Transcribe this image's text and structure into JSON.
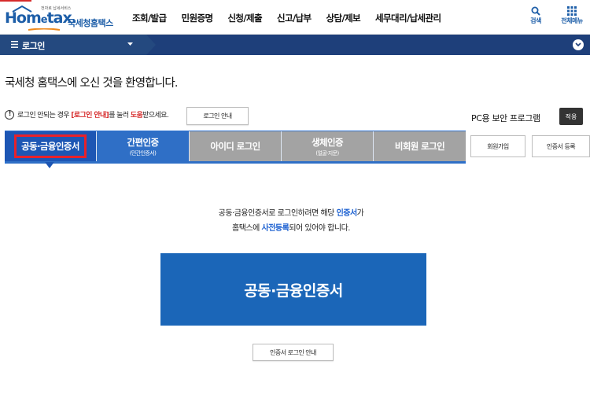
{
  "header": {
    "logo_small": "전자로 납세서비스",
    "logo_brand_a": "Hom",
    "logo_brand_e": "e",
    "logo_brand_b": "tax.",
    "logo_ko": "국세청홈택스",
    "nav": [
      "조회/발급",
      "민원증명",
      "신청/제출",
      "신고/납부",
      "상담/제보",
      "세무대리/납세관리"
    ],
    "search_label": "검색",
    "allmenu_label": "전체메뉴",
    "accent": "#1d5ea8"
  },
  "navbar": {
    "label": "로그인",
    "bg": "#1e3f7a"
  },
  "welcome": "국세청 홈택스에 오신 것을 환영합니다.",
  "notice": {
    "pre": "로그인 안되는 경우",
    "hl1": "[로그인 안내]",
    "mid": "를 눌러",
    "hl2": "도움",
    "post": "받으세요.",
    "guide_button": "로그인 안내"
  },
  "security": {
    "label": "PC용 보안 프로그램",
    "apply_button": "적용"
  },
  "tabs": [
    {
      "label": "공동·금융인증서",
      "sub": "",
      "active": true
    },
    {
      "label": "간편인증",
      "sub": "(민간인증서)",
      "active": false
    },
    {
      "label": "아이디 로그인",
      "sub": "",
      "active": false
    },
    {
      "label": "생체인증",
      "sub": "(얼굴·지문)",
      "active": false
    },
    {
      "label": "비회원 로그인",
      "sub": "",
      "active": false
    }
  ],
  "side_buttons": {
    "join": "회원가입",
    "cert_register": "인증서 등록"
  },
  "description": {
    "line1_pre": "공동·금융인증서로 로그인하려면 해당",
    "line1_hl": "인증서",
    "line1_post": "가",
    "line2_pre": "홈택스에",
    "line2_hl": "사전등록",
    "line2_post": "되어 있어야 합니다."
  },
  "main_button": "공동·금융인증서",
  "cert_guide_button": "인증서 로그인 안내"
}
